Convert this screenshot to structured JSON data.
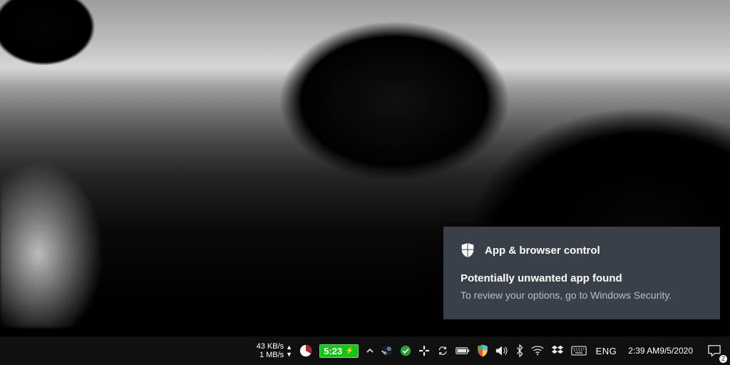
{
  "notification": {
    "title": "App & browser control",
    "headline": "Potentially unwanted app found",
    "body": "To review your options, go to Windows Security."
  },
  "network_speed": {
    "down": "43 KB/s",
    "up": "1 MB/s"
  },
  "battery": {
    "time_remaining": "5:23"
  },
  "language_indicator": "ENG",
  "clock": {
    "time": "2:39 AM",
    "date": "9/5/2020"
  },
  "action_center": {
    "badge_count": "2"
  }
}
